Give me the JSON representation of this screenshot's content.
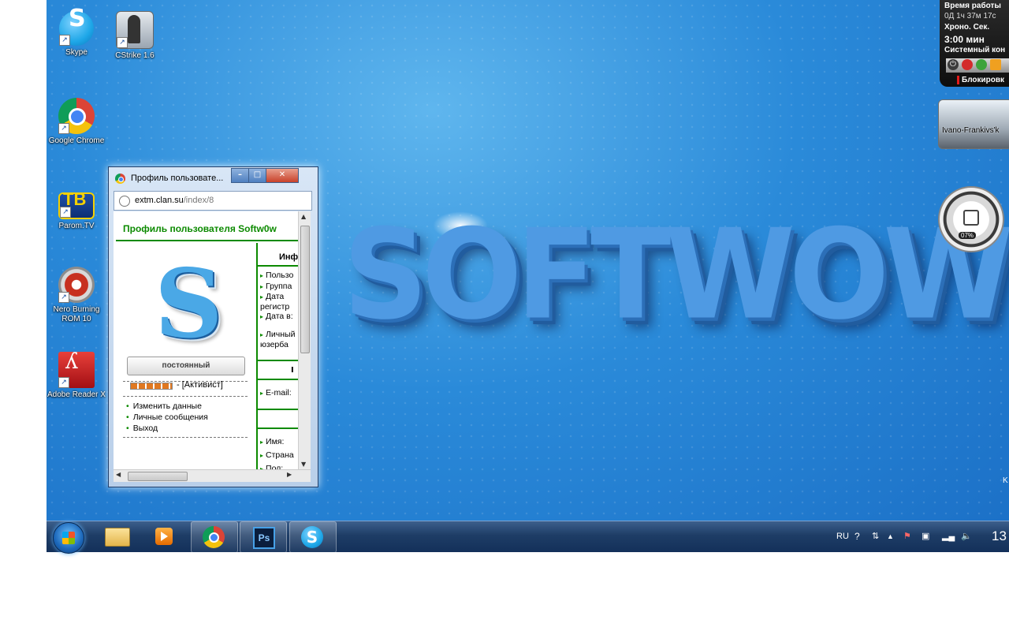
{
  "desktop": {
    "icons": [
      {
        "label": "Skype",
        "icon": "skype-icon",
        "color": "#1ea7e8"
      },
      {
        "label": "CStrike 1.6",
        "icon": "cstrike-icon",
        "color": "#6b7a8a"
      },
      {
        "label": "Google Chrome",
        "icon": "chrome-icon",
        "color": "#db4437"
      },
      {
        "label": "Parom.TV",
        "icon": "paromtv-icon",
        "color": "#f4d000"
      },
      {
        "label": "Nero Burning ROM 10",
        "icon": "nero-icon",
        "color": "#c7301f"
      },
      {
        "label": "Adobe Reader X",
        "icon": "adobe-reader-icon",
        "color": "#c4161c"
      }
    ],
    "wallpaper_text": "SOFTWOW"
  },
  "browser": {
    "title": "Профиль пользовате...",
    "url_domain": "extm.clan.su",
    "url_path": "/index/8",
    "page_title": "Профиль пользователя Softw0w",
    "logo_letter": "S",
    "rank_button": "постоянный",
    "rank_label": "- [Активист]",
    "menu": [
      "Изменить данные",
      "Личные сообщения",
      "Выход"
    ],
    "info_head": "Инф",
    "info_items": [
      "Пользо",
      "Группа",
      "Дата регистр",
      "Дата в:",
      "Личный юзерба"
    ],
    "section_mark": "I",
    "email_label": "E-mail:",
    "personal_items": [
      "Имя:",
      "Страна",
      "Пол:"
    ]
  },
  "gadgets": {
    "timer": {
      "line1": "Время работы",
      "line2": "0Д 1ч 37м 17с",
      "line3": "Хроно.  Сек.",
      "line4": "3:00 мин",
      "line5": "Системный кон",
      "lock_label": "Блокировк"
    },
    "weather": {
      "city": "Ivano-Frankivs'k"
    },
    "meter": {
      "value": "07%"
    }
  },
  "taskbar": {
    "apps": [
      "explorer-icon",
      "media-player-icon",
      "chrome-icon",
      "photoshop-icon",
      "skype-icon"
    ],
    "active_app": "chrome-icon",
    "photoshop_label": "Ps",
    "lang": "RU",
    "clock": "13"
  },
  "right_edge_letter": "K"
}
